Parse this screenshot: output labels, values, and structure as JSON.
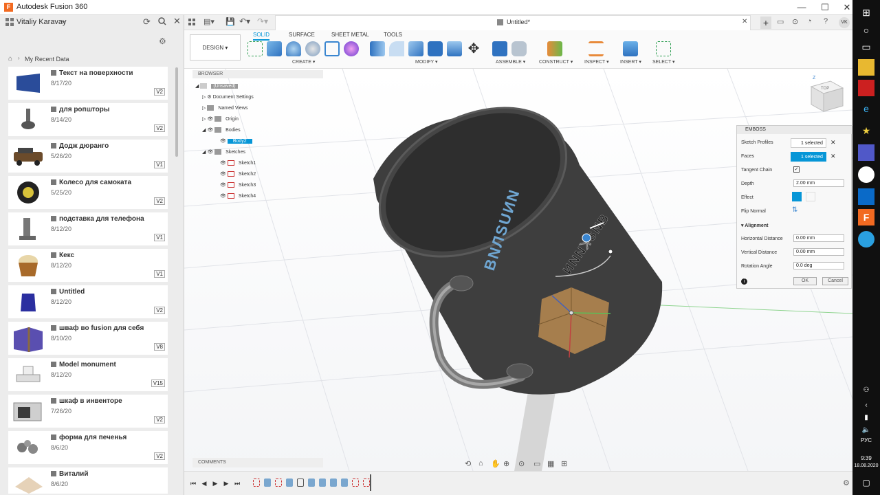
{
  "app": {
    "title": "Autodesk Fusion 360",
    "logo": "F",
    "window_controls": [
      "—",
      "☐",
      "✕"
    ]
  },
  "data_panel": {
    "user": "Vitaliy Karavay",
    "breadcrumb": "My Recent Data",
    "items": [
      {
        "name": "Текст на поверхности",
        "date": "8/17/20",
        "version": "V2"
      },
      {
        "name": "для ропшторы",
        "date": "8/14/20",
        "version": "V2"
      },
      {
        "name": "Додж дюранго",
        "date": "5/26/20",
        "version": "V1"
      },
      {
        "name": "Колесо для самоката",
        "date": "5/25/20",
        "version": "V2"
      },
      {
        "name": "подставка для телефона",
        "date": "8/12/20",
        "version": "V1"
      },
      {
        "name": "Кекс",
        "date": "8/12/20",
        "version": "V1"
      },
      {
        "name": "Untitled",
        "date": "8/12/20",
        "version": "V2"
      },
      {
        "name": "шваф во fusion для себя",
        "date": "8/10/20",
        "version": "V8"
      },
      {
        "name": "Model monument",
        "date": "8/12/20",
        "version": "V15"
      },
      {
        "name": "шкаф в инвенторе",
        "date": "7/26/20",
        "version": "V2"
      },
      {
        "name": "форма для печенья",
        "date": "8/6/20",
        "version": "V2"
      },
      {
        "name": "Виталий",
        "date": "8/6/20",
        "version": ""
      }
    ]
  },
  "document": {
    "tab_title": "Untitled*"
  },
  "ribbon": {
    "workspace": "DESIGN",
    "tabs": [
      "SOLID",
      "SURFACE",
      "SHEET METAL",
      "TOOLS"
    ],
    "active_tab": "SOLID",
    "groups": [
      "CREATE",
      "MODIFY",
      "ASSEMBLE",
      "CONSTRUCT",
      "INSPECT",
      "INSERT",
      "SELECT"
    ]
  },
  "browser": {
    "header": "BROWSER",
    "root": "(Unsaved)",
    "nodes": [
      "Document Settings",
      "Named Views",
      "Origin",
      "Bodies",
      "Body2",
      "Sketches",
      "Sketch1",
      "Sketch2",
      "Sketch3",
      "Sketch4"
    ]
  },
  "emboss": {
    "title": "EMBOSS",
    "sketch_profiles_label": "Sketch Profiles",
    "sketch_profiles_value": "1 selected",
    "faces_label": "Faces",
    "faces_value": "1 selected",
    "tangent_chain_label": "Tangent Chain",
    "depth_label": "Depth",
    "depth_value": "2.00 mm",
    "effect_label": "Effect",
    "flip_normal_label": "Flip Normal",
    "alignment_label": "Alignment",
    "horizontal_distance_label": "Horizontal Distance",
    "horizontal_distance_value": "0.00 mm",
    "vertical_distance_label": "Vertical Distance",
    "vertical_distance_value": "0.00 mm",
    "rotation_angle_label": "Rotation Angle",
    "rotation_angle_value": "0.0 deg",
    "ok_label": "OK",
    "cancel_label": "Cancel"
  },
  "comments": {
    "label": "COMMENTS"
  },
  "viewcube": {
    "top_label": "TOP",
    "axis_z": "Z"
  },
  "taskbar": {
    "language": "РУС",
    "time": "9:39",
    "date": "18.08.2020"
  },
  "profile": {
    "initials": "VK"
  },
  "colors": {
    "accent": "#0696d7",
    "fusion_orange": "#f26a21",
    "mug_body": "#3d3d3d"
  }
}
